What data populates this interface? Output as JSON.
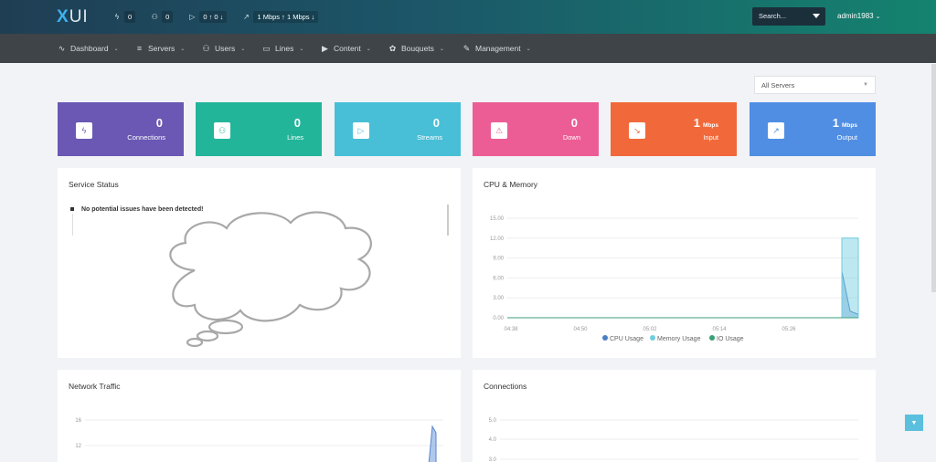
{
  "brand": {
    "x": "X",
    "ui": "UI"
  },
  "topstats": [
    {
      "icon": "bolt-icon",
      "glyph": "ϟ",
      "value": "0"
    },
    {
      "icon": "users-icon",
      "glyph": "⚇",
      "value": "0"
    },
    {
      "icon": "play-icon",
      "glyph": "▷",
      "value": "0 ↑ 0 ↓"
    },
    {
      "icon": "trend-icon",
      "glyph": "↗",
      "value": "1 Mbps ↑ 1 Mbps ↓"
    }
  ],
  "search": {
    "label": "Search..."
  },
  "user": {
    "name": "admin1983"
  },
  "nav": [
    {
      "id": "dashboard",
      "label": "Dashboard",
      "glyph": "∿"
    },
    {
      "id": "servers",
      "label": "Servers",
      "glyph": "≡"
    },
    {
      "id": "users",
      "label": "Users",
      "glyph": "⚇"
    },
    {
      "id": "lines",
      "label": "Lines",
      "glyph": "▭"
    },
    {
      "id": "content",
      "label": "Content",
      "glyph": "▶"
    },
    {
      "id": "bouquets",
      "label": "Bouquets",
      "glyph": "✿"
    },
    {
      "id": "management",
      "label": "Management",
      "glyph": "✎"
    }
  ],
  "server_select": {
    "value": "All Servers"
  },
  "cards": [
    {
      "id": "connections",
      "label": "Connections",
      "value": "0",
      "unit": "",
      "color": "#6a58b4",
      "icon": "bolt-icon",
      "glyph": "ϟ"
    },
    {
      "id": "lines",
      "label": "Lines",
      "value": "0",
      "unit": "",
      "color": "#23b59a",
      "icon": "users-icon",
      "glyph": "⚇"
    },
    {
      "id": "streams",
      "label": "Streams",
      "value": "0",
      "unit": "",
      "color": "#48bfd7",
      "icon": "play-icon",
      "glyph": "▷"
    },
    {
      "id": "down",
      "label": "Down",
      "value": "0",
      "unit": "",
      "color": "#ec5d95",
      "icon": "warning-icon",
      "glyph": "⚠"
    },
    {
      "id": "input",
      "label": "Input",
      "value": "1",
      "unit": "Mbps",
      "color": "#f1693a",
      "icon": "trend-down-icon",
      "glyph": "↘"
    },
    {
      "id": "output",
      "label": "Output",
      "value": "1",
      "unit": "Mbps",
      "color": "#4f8ee3",
      "icon": "trend-up-icon",
      "glyph": "↗"
    }
  ],
  "panels": {
    "service_status": {
      "title": "Service Status",
      "message": "No potential issues have been detected!"
    },
    "cpu_memory": {
      "title": "CPU & Memory"
    },
    "network_traffic": {
      "title": "Network Traffic"
    },
    "connections": {
      "title": "Connections"
    }
  },
  "chart_data": [
    {
      "type": "area",
      "title": "CPU & Memory",
      "x": [
        "04:38",
        "04:50",
        "05:02",
        "05:14",
        "05:26"
      ],
      "ylim": [
        0,
        15
      ],
      "yticks": [
        "15.00",
        "12.00",
        "9.00",
        "6.00",
        "3.00",
        "0.00"
      ],
      "series": [
        {
          "name": "CPU Usage",
          "color": "#4a7fc4",
          "values": [
            0,
            0,
            0,
            0,
            0,
            0,
            7,
            1,
            0.5
          ]
        },
        {
          "name": "Memory Usage",
          "color": "#6fcde0",
          "values": [
            0,
            0,
            0,
            0,
            0,
            0,
            12,
            12,
            12
          ]
        },
        {
          "name": "IO Usage",
          "color": "#3aa078",
          "values": [
            0,
            0,
            0,
            0,
            0,
            0,
            0,
            0,
            0
          ]
        }
      ],
      "legend": "bottom"
    },
    {
      "type": "area",
      "title": "Network Traffic",
      "yticks": [
        "16",
        "12"
      ],
      "series": [
        {
          "color": "#7aa3e0",
          "values": [
            0,
            0,
            0,
            0,
            0,
            0,
            0,
            15,
            14
          ]
        }
      ]
    },
    {
      "type": "line",
      "title": "Connections",
      "yticks": [
        "5.0",
        "4.0",
        "3.0"
      ],
      "series": []
    }
  ]
}
